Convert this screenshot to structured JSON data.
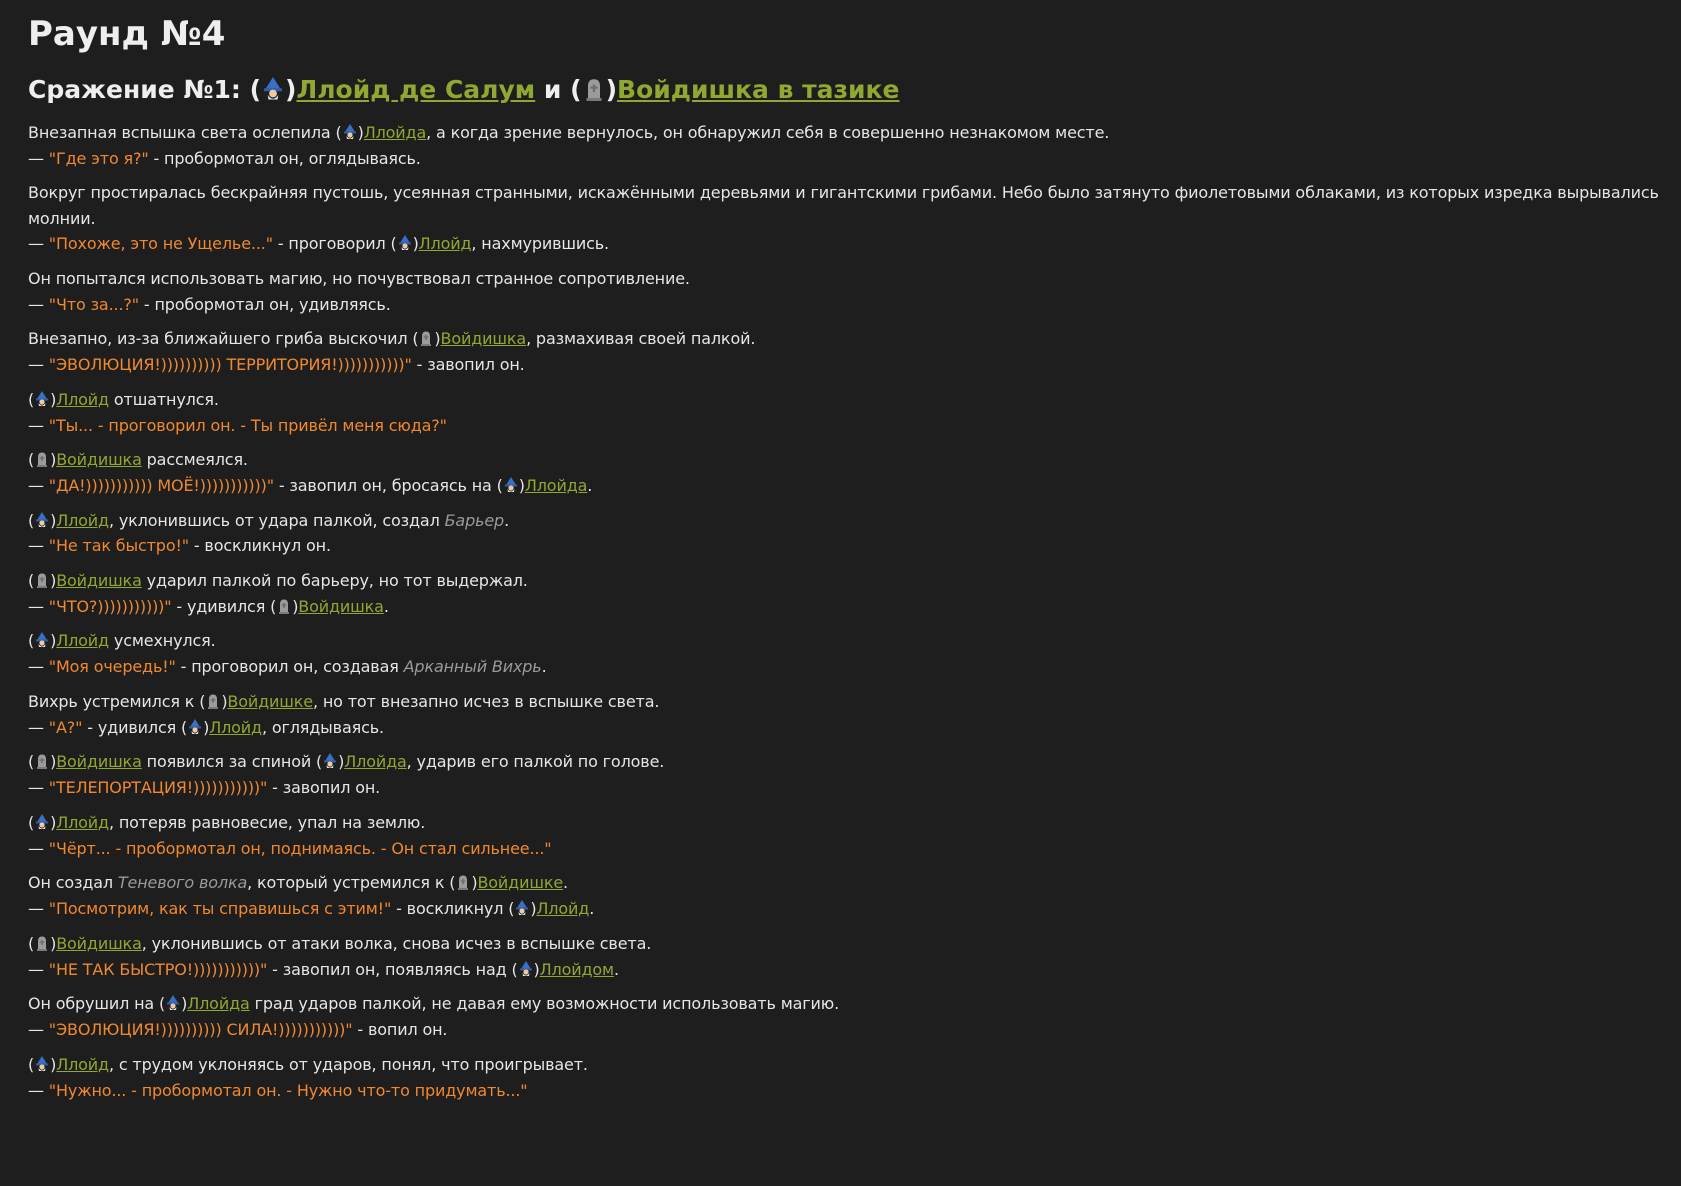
{
  "round_title": "Раунд №4",
  "battle": {
    "prefix": "Сражение №1: (",
    "p1_close": ")",
    "fighter1": "Ллойд де Салум",
    "and": " и (",
    "p2_close": ")",
    "fighter2": "Войдишка в тазике",
    "fighter1_icon": "wizard-icon",
    "fighter2_icon": "tombstone-icon"
  },
  "colors": {
    "background": "#1e1e1e",
    "text": "#e6e6e6",
    "name": "#8fa832",
    "speech": "#f08830",
    "spell": "#9a9a9a"
  },
  "story": [
    [
      {
        "t": "Внезапная вспышка света ослепила ("
      },
      {
        "i": "wizard"
      },
      {
        "t": ")"
      },
      {
        "n": "Ллойда"
      },
      {
        "t": ", а когда зрение вернулось, он обнаружил себя в совершенно незнакомом месте."
      }
    ],
    [
      {
        "t": "— "
      },
      {
        "q": "\"Где это я?\""
      },
      {
        "t": " - пробормотал он, оглядываясь."
      }
    ],
    [
      {
        "t": "Вокруг простиралась бескрайняя пустошь, усеянная странными, искажёнными деревьями и гигантскими грибами. Небо было затянуто фиолетовыми облаками, из которых изредка вырывались молнии."
      }
    ],
    [
      {
        "t": "— "
      },
      {
        "q": "\"Похоже, это не Ущелье...\""
      },
      {
        "t": " - проговорил ("
      },
      {
        "i": "wizard"
      },
      {
        "t": ")"
      },
      {
        "n": "Ллойд"
      },
      {
        "t": ", нахмурившись."
      }
    ],
    [
      {
        "t": "Он попытался использовать магию, но почувствовал странное сопротивление."
      }
    ],
    [
      {
        "t": "— "
      },
      {
        "q": "\"Что за...?\""
      },
      {
        "t": " - пробормотал он, удивляясь."
      }
    ],
    [
      {
        "t": "Внезапно, из-за ближайшего гриба выскочил ("
      },
      {
        "i": "tomb"
      },
      {
        "t": ")"
      },
      {
        "n": "Войдишка"
      },
      {
        "t": ", размахивая своей палкой."
      }
    ],
    [
      {
        "t": "— "
      },
      {
        "q": "\"ЭВОЛЮЦИЯ!)))))))))) ТЕРРИТОРИЯ!)))))))))))\""
      },
      {
        "t": " - завопил он."
      }
    ],
    [
      {
        "t": "("
      },
      {
        "i": "wizard"
      },
      {
        "t": ")"
      },
      {
        "n": "Ллойд"
      },
      {
        "t": " отшатнулся."
      }
    ],
    [
      {
        "t": "— "
      },
      {
        "q": "\"Ты... - проговорил он. - Ты привёл меня сюда?\""
      }
    ],
    [
      {
        "t": "("
      },
      {
        "i": "tomb"
      },
      {
        "t": ")"
      },
      {
        "n": "Войдишка"
      },
      {
        "t": " рассмеялся."
      }
    ],
    [
      {
        "t": "— "
      },
      {
        "q": "\"ДА!))))))))))) МОЁ!)))))))))))\""
      },
      {
        "t": " - завопил он, бросаясь на ("
      },
      {
        "i": "wizard"
      },
      {
        "t": ")"
      },
      {
        "n": "Ллойда"
      },
      {
        "t": "."
      }
    ],
    [
      {
        "t": "("
      },
      {
        "i": "wizard"
      },
      {
        "t": ")"
      },
      {
        "n": "Ллойд"
      },
      {
        "t": ", уклонившись от удара палкой, создал "
      },
      {
        "s": "Барьер"
      },
      {
        "t": "."
      }
    ],
    [
      {
        "t": "— "
      },
      {
        "q": "\"Не так быстро!\""
      },
      {
        "t": " - воскликнул он."
      }
    ],
    [
      {
        "t": "("
      },
      {
        "i": "tomb"
      },
      {
        "t": ")"
      },
      {
        "n": "Войдишка"
      },
      {
        "t": " ударил палкой по барьеру, но тот выдержал."
      }
    ],
    [
      {
        "t": "— "
      },
      {
        "q": "\"ЧТО?)))))))))))\""
      },
      {
        "t": " - удивился ("
      },
      {
        "i": "tomb"
      },
      {
        "t": ")"
      },
      {
        "n": "Войдишка"
      },
      {
        "t": "."
      }
    ],
    [
      {
        "t": "("
      },
      {
        "i": "wizard"
      },
      {
        "t": ")"
      },
      {
        "n": "Ллойд"
      },
      {
        "t": " усмехнулся."
      }
    ],
    [
      {
        "t": "— "
      },
      {
        "q": "\"Моя очередь!\""
      },
      {
        "t": " - проговорил он, создавая "
      },
      {
        "s": "Арканный Вихрь"
      },
      {
        "t": "."
      }
    ],
    [
      {
        "t": "Вихрь устремился к ("
      },
      {
        "i": "tomb"
      },
      {
        "t": ")"
      },
      {
        "n": "Войдишке"
      },
      {
        "t": ", но тот внезапно исчез в вспышке света."
      }
    ],
    [
      {
        "t": "— "
      },
      {
        "q": "\"А?\""
      },
      {
        "t": " - удивился ("
      },
      {
        "i": "wizard"
      },
      {
        "t": ")"
      },
      {
        "n": "Ллойд"
      },
      {
        "t": ", оглядываясь."
      }
    ],
    [
      {
        "t": "("
      },
      {
        "i": "tomb"
      },
      {
        "t": ")"
      },
      {
        "n": "Войдишка"
      },
      {
        "t": " появился за спиной ("
      },
      {
        "i": "wizard"
      },
      {
        "t": ")"
      },
      {
        "n": "Ллойда"
      },
      {
        "t": ", ударив его палкой по голове."
      }
    ],
    [
      {
        "t": "— "
      },
      {
        "q": "\"ТЕЛЕПОРТАЦИЯ!)))))))))))\""
      },
      {
        "t": " - завопил он."
      }
    ],
    [
      {
        "t": "("
      },
      {
        "i": "wizard"
      },
      {
        "t": ")"
      },
      {
        "n": "Ллойд"
      },
      {
        "t": ", потеряв равновесие, упал на землю."
      }
    ],
    [
      {
        "t": "— "
      },
      {
        "q": "\"Чёрт... - пробормотал он, поднимаясь. - Он стал сильнее...\""
      }
    ],
    [
      {
        "t": "Он создал "
      },
      {
        "s": "Теневого волка"
      },
      {
        "t": ", который устремился к ("
      },
      {
        "i": "tomb"
      },
      {
        "t": ")"
      },
      {
        "n": "Войдишке"
      },
      {
        "t": "."
      }
    ],
    [
      {
        "t": "— "
      },
      {
        "q": "\"Посмотрим, как ты справишься с этим!\""
      },
      {
        "t": " - воскликнул ("
      },
      {
        "i": "wizard"
      },
      {
        "t": ")"
      },
      {
        "n": "Ллойд"
      },
      {
        "t": "."
      }
    ],
    [
      {
        "t": "("
      },
      {
        "i": "tomb"
      },
      {
        "t": ")"
      },
      {
        "n": "Войдишка"
      },
      {
        "t": ", уклонившись от атаки волка, снова исчез в вспышке света."
      }
    ],
    [
      {
        "t": "— "
      },
      {
        "q": "\"НЕ ТАК БЫСТРО!)))))))))))\""
      },
      {
        "t": " - завопил он, появляясь над ("
      },
      {
        "i": "wizard"
      },
      {
        "t": ")"
      },
      {
        "n": "Ллойдом"
      },
      {
        "t": "."
      }
    ],
    [
      {
        "t": "Он обрушил на ("
      },
      {
        "i": "wizard"
      },
      {
        "t": ")"
      },
      {
        "n": "Ллойда"
      },
      {
        "t": " град ударов палкой, не давая ему возможности использовать магию."
      }
    ],
    [
      {
        "t": "— "
      },
      {
        "q": "\"ЭВОЛЮЦИЯ!)))))))))) СИЛА!)))))))))))\""
      },
      {
        "t": " - вопил он."
      }
    ],
    [
      {
        "t": "("
      },
      {
        "i": "wizard"
      },
      {
        "t": ")"
      },
      {
        "n": "Ллойд"
      },
      {
        "t": ", с трудом уклоняясь от ударов, понял, что проигрывает."
      }
    ],
    [
      {
        "t": "— "
      },
      {
        "q": "\"Нужно... - пробормотал он. - Нужно что-то придумать...\""
      }
    ]
  ]
}
